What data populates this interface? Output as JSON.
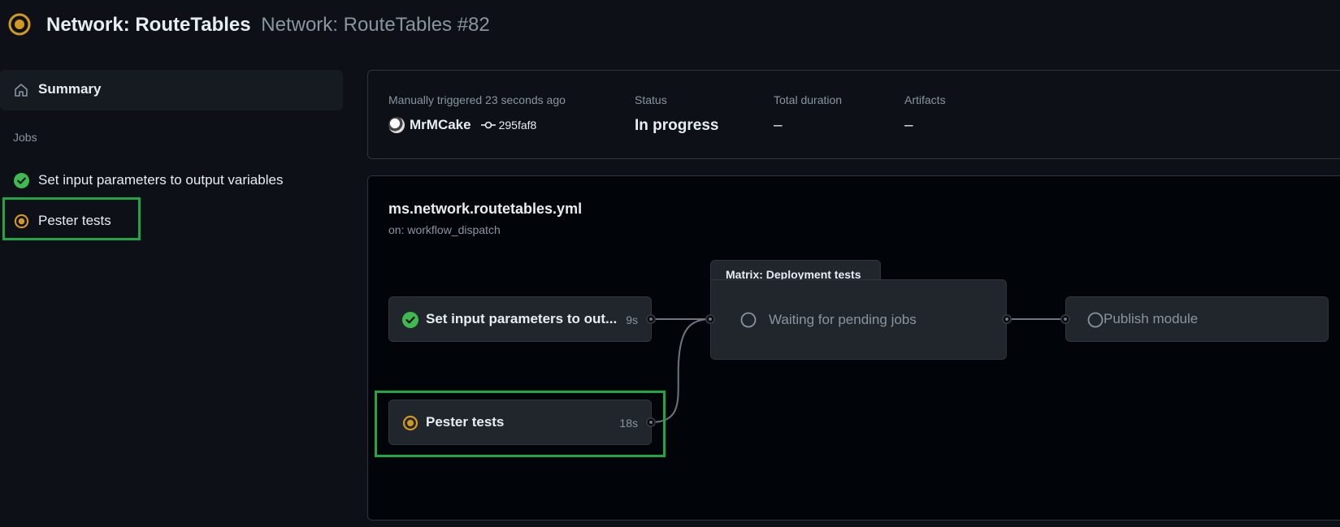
{
  "header": {
    "workflow_name": "Network: RouteTables",
    "run_title": "Network: RouteTables #82"
  },
  "sidebar": {
    "summary_label": "Summary",
    "jobs_heading": "Jobs",
    "jobs": [
      {
        "label": "Set input parameters to output variables",
        "status": "success"
      },
      {
        "label": "Pester tests",
        "status": "in_progress"
      }
    ]
  },
  "info": {
    "trigger_text": "Manually triggered 23 seconds ago",
    "actor": "MrMCake",
    "commit_sha": "295faf8",
    "status_label": "Status",
    "status_value": "In progress",
    "duration_label": "Total duration",
    "duration_value": "–",
    "artifacts_label": "Artifacts",
    "artifacts_value": "–"
  },
  "graph": {
    "workflow_file": "ms.network.routetables.yml",
    "trigger": "on: workflow_dispatch",
    "nodes": {
      "set_params": {
        "name": "Set input parameters to out...",
        "duration": "9s",
        "status": "success"
      },
      "pester": {
        "name": "Pester tests",
        "duration": "18s",
        "status": "in_progress"
      },
      "matrix": {
        "title": "Matrix: Deployment tests",
        "name": "Waiting for pending jobs",
        "status": "pending"
      },
      "publish": {
        "name": "Publish module",
        "status": "pending"
      }
    }
  },
  "colors": {
    "success": "#3fb950",
    "in_progress": "#d29922",
    "highlight": "#1fa745"
  }
}
